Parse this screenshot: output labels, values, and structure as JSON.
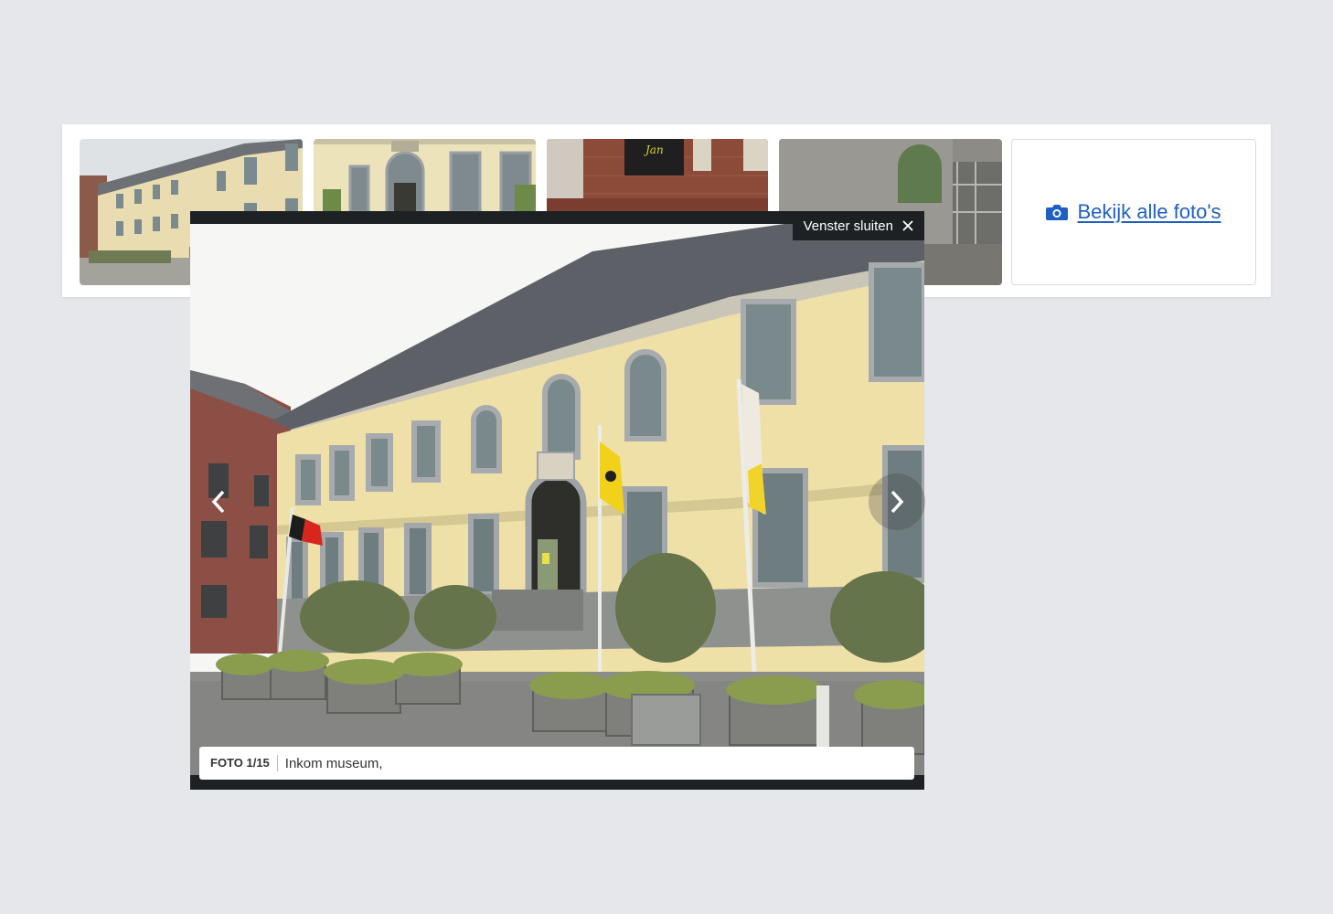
{
  "gallery": {
    "view_all_label": "Bekijk alle foto's",
    "view_all_icon": "camera-icon",
    "thumbnails": [
      {
        "subject": "museum-facade-wide"
      },
      {
        "subject": "museum-entrance"
      },
      {
        "subject": "brick-building-poster"
      },
      {
        "subject": "stone-wall-green-door"
      }
    ]
  },
  "lightbox": {
    "close_label": "Venster sluiten",
    "close_icon": "close-icon",
    "prev_icon": "chevron-left-icon",
    "next_icon": "chevron-right-icon",
    "counter": "FOTO 1/15",
    "caption": "Inkom museum,"
  },
  "colors": {
    "background": "#e6e7ea",
    "link": "#1f5fc4",
    "lightbox_frame": "#1e2124"
  }
}
